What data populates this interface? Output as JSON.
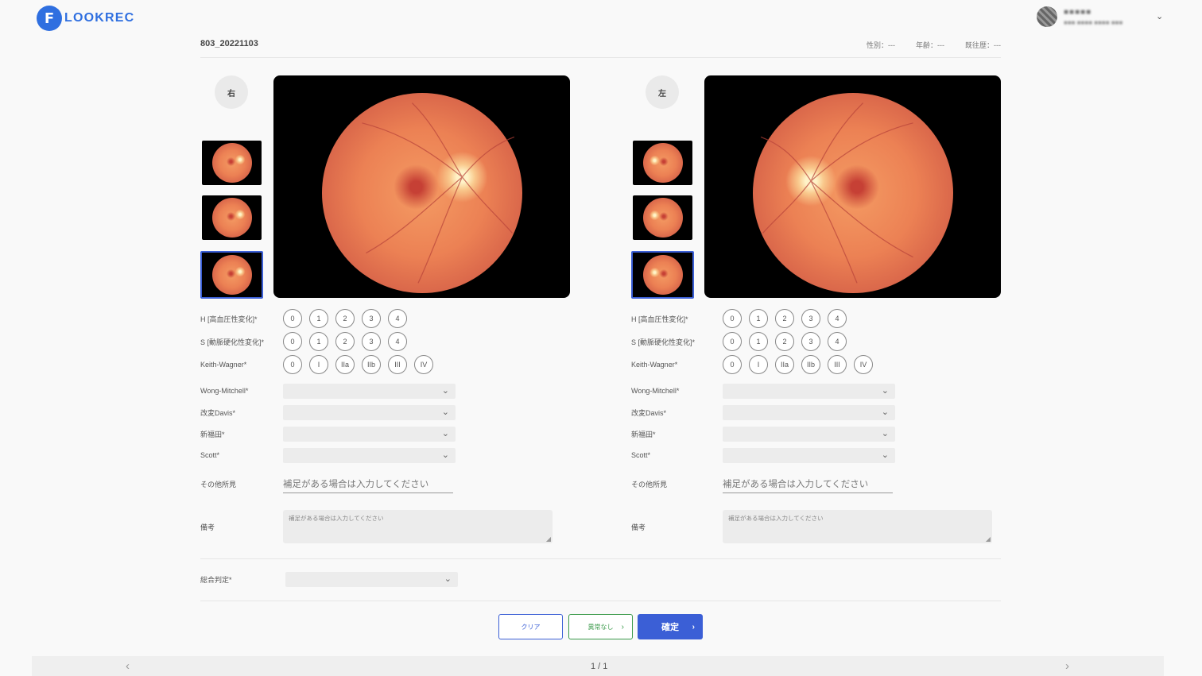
{
  "app": {
    "logo_mark": "F",
    "logo_text": "LOOKREC"
  },
  "user": {
    "name": "■■■■■",
    "subtitle": "■■■ ■■■■ ■■■■ ■■■",
    "menu_icon": "chevron-down-icon"
  },
  "record": {
    "id": "803_20221103",
    "sex": "性別：---",
    "age": "年齢：---",
    "history": "既往歴：---"
  },
  "eyes": {
    "right": {
      "side_label": "右",
      "rows": {
        "h_label": "H [高血圧性変化]*",
        "h_options": [
          "0",
          "1",
          "2",
          "3",
          "4"
        ],
        "s_label": "S [動脈硬化性変化]*",
        "s_options": [
          "0",
          "1",
          "2",
          "3",
          "4"
        ],
        "kw_label": "Keith-Wagner*",
        "kw_options": [
          "0",
          "I",
          "IIa",
          "IIb",
          "III",
          "IV"
        ],
        "wm_label": "Wong-Mitchell*",
        "davis_label": "改変Davis*",
        "fukuda_label": "新福田*",
        "scott_label": "Scott*",
        "other_label": "その他所見",
        "other_placeholder": "補足がある場合は入力してください",
        "note_label": "備考",
        "note_placeholder": "補足がある場合は入力してください"
      }
    },
    "left": {
      "side_label": "左",
      "rows": {
        "h_label": "H [高血圧性変化]*",
        "h_options": [
          "0",
          "1",
          "2",
          "3",
          "4"
        ],
        "s_label": "S [動脈硬化性変化]*",
        "s_options": [
          "0",
          "1",
          "2",
          "3",
          "4"
        ],
        "kw_label": "Keith-Wagner*",
        "kw_options": [
          "0",
          "I",
          "IIa",
          "IIb",
          "III",
          "IV"
        ],
        "wm_label": "Wong-Mitchell*",
        "davis_label": "改変Davis*",
        "fukuda_label": "新福田*",
        "scott_label": "Scott*",
        "other_label": "その他所見",
        "other_placeholder": "補足がある場合は入力してください",
        "note_label": "備考",
        "note_placeholder": "補足がある場合は入力してください"
      }
    }
  },
  "overall": {
    "label": "総合判定*"
  },
  "actions": {
    "clear": "クリア",
    "no_abnormality": "異常なし",
    "confirm": "確定",
    "arrow": "›"
  },
  "pager": {
    "text": "1 / 1",
    "prev": "‹",
    "next": "›"
  },
  "colors": {
    "accent": "#3b5fd6",
    "success": "#3a9a4a",
    "logo": "#2f6fe0"
  }
}
